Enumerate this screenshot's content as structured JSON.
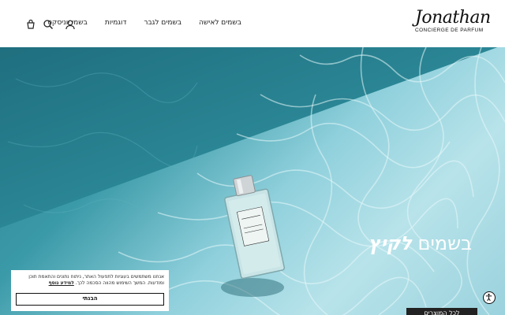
{
  "header": {
    "logo_script": "Jonathan",
    "logo_sub": "CONCIERGE DE PARFUM",
    "nav": [
      {
        "label": "בשמים לאישה"
      },
      {
        "label": "בשמים לגבר"
      },
      {
        "label": "דוגמיות"
      },
      {
        "label": "בשמי יוניסקס"
      }
    ],
    "icons": [
      "cart-icon",
      "search-icon",
      "user-icon"
    ]
  },
  "hero": {
    "title_light": "בשמים",
    "title_bold": "לקיץ",
    "cta_label": "לכל המוצרים"
  },
  "cookie": {
    "text": "אנחנו משתמשים בעוגיות לתפעול האתר, ניתוח נתונים והתאמת תוכן ומודעות. המשך השימוש מהווה הסכמה לכך.",
    "link": "למידע נוסף",
    "button": "הבנתי"
  },
  "colors": {
    "accent": "#222222",
    "water": "#3b9aa8"
  }
}
